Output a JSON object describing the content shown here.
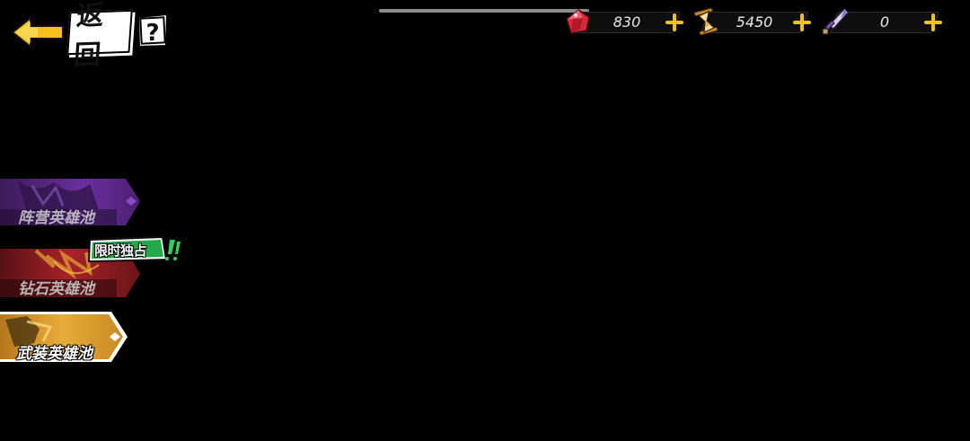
{
  "top_progress": {
    "fill_fraction": 1.0
  },
  "header": {
    "back_label": "返回",
    "help_label": "?"
  },
  "currencies": [
    {
      "icon": "ruby-gem-icon",
      "value": "830",
      "color": "#d8283c"
    },
    {
      "icon": "hourglass-icon",
      "value": "5450",
      "color": "#e8b24a"
    },
    {
      "icon": "sword-token-icon",
      "value": "0",
      "color": "#b8a6d8"
    }
  ],
  "tabs": [
    {
      "label": "阵营英雄池",
      "state": "inactive",
      "color": "#7a3aa8"
    },
    {
      "label": "钻石英雄池",
      "state": "inactive",
      "color": "#a8232a",
      "badge": "限时独占"
    },
    {
      "label": "武装英雄池",
      "state": "active",
      "color": "#e2a83a"
    }
  ],
  "colors": {
    "accent_yellow": "#f2c21b",
    "badge_green": "#2fb84a"
  }
}
